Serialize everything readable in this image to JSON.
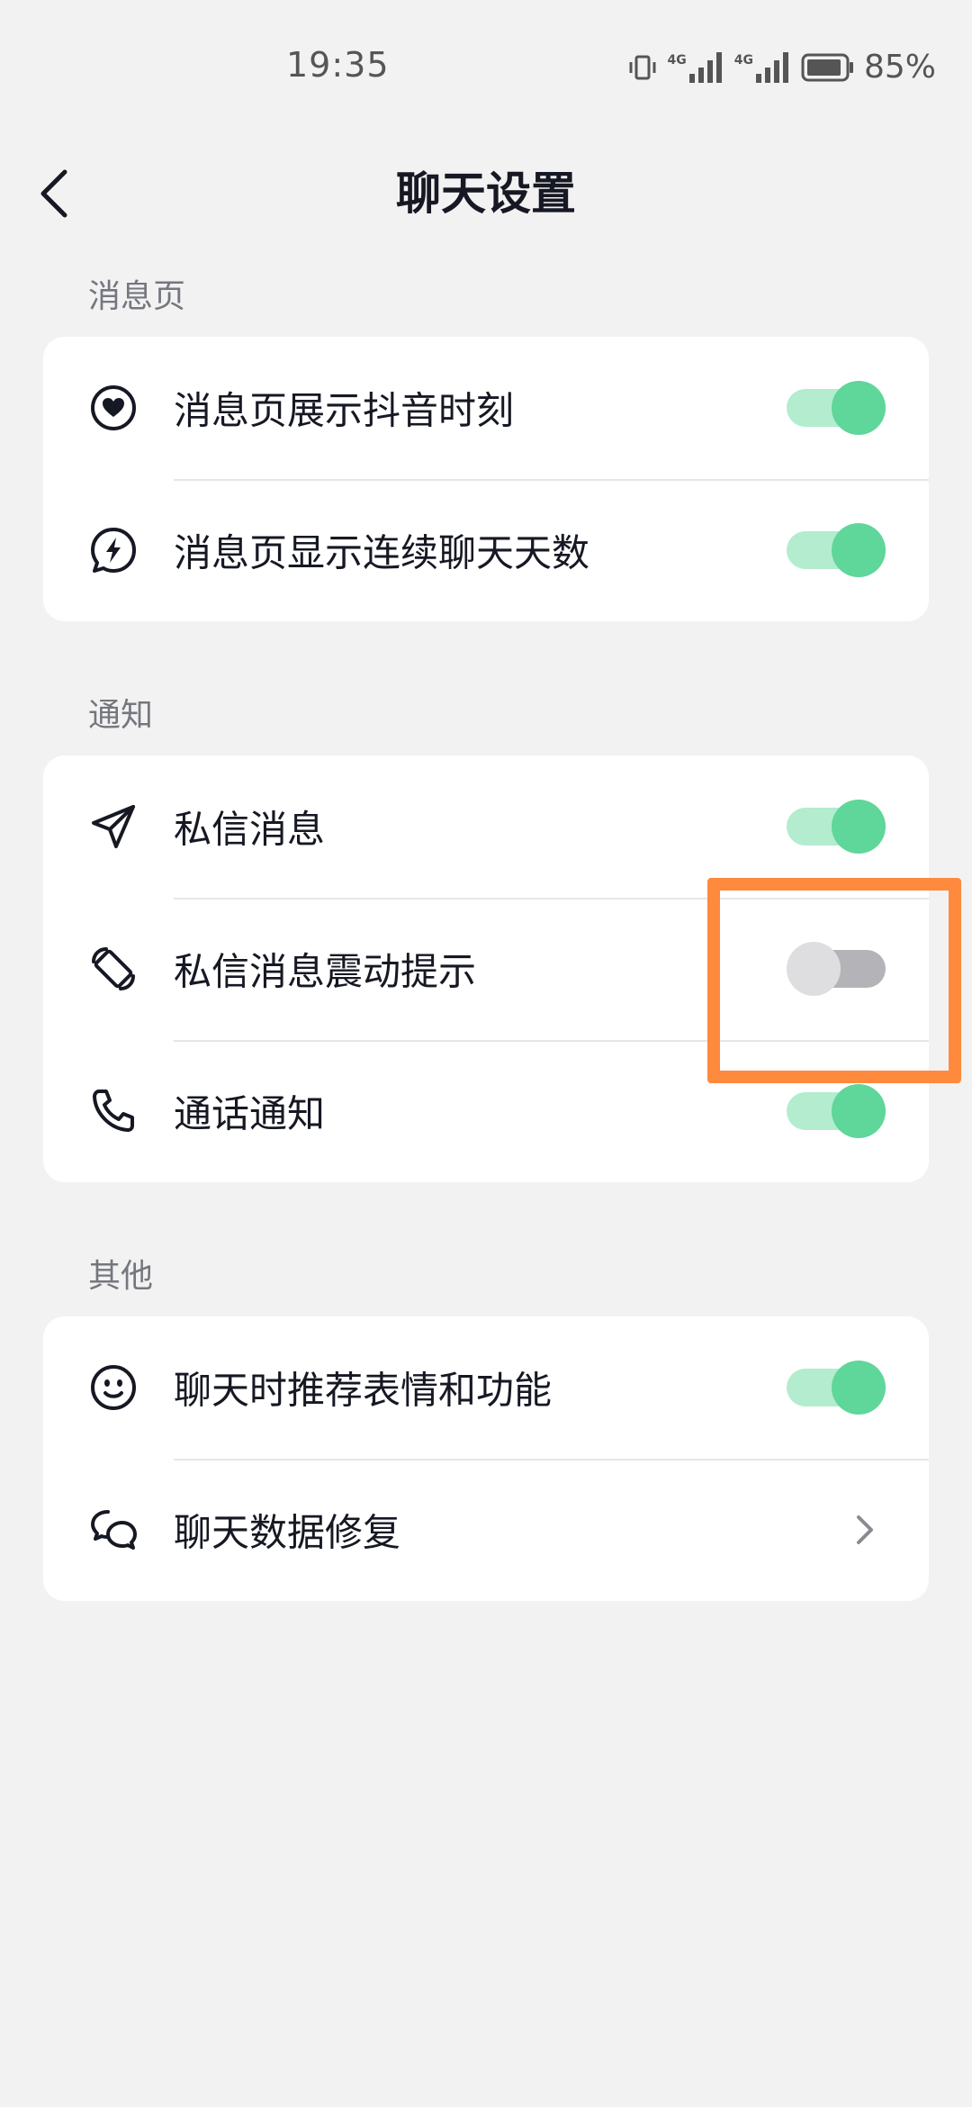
{
  "status_bar": {
    "time": "19:35",
    "network_1": "4G",
    "network_2": "4G",
    "battery": "85%"
  },
  "header": {
    "title": "聊天设置",
    "back_icon": "chevron-left-icon"
  },
  "sections": [
    {
      "label": "消息页",
      "items": [
        {
          "label": "消息页展示抖音时刻",
          "icon": "heart-circle-icon",
          "control": "toggle",
          "on": true
        },
        {
          "label": "消息页显示连续聊天天数",
          "icon": "lightning-bubble-icon",
          "control": "toggle",
          "on": true
        }
      ]
    },
    {
      "label": "通知",
      "items": [
        {
          "label": "私信消息",
          "icon": "paper-plane-icon",
          "control": "toggle",
          "on": true
        },
        {
          "label": "私信消息震动提示",
          "icon": "vibrate-phone-icon",
          "control": "toggle",
          "on": false
        },
        {
          "label": "通话通知",
          "icon": "phone-icon",
          "control": "toggle",
          "on": true
        }
      ]
    },
    {
      "label": "其他",
      "items": [
        {
          "label": "聊天时推荐表情和功能",
          "icon": "smiley-icon",
          "control": "toggle",
          "on": true
        },
        {
          "label": "聊天数据修复",
          "icon": "chat-bubbles-icon",
          "control": "chevron"
        }
      ]
    }
  ],
  "colors": {
    "toggle_on_track": "#b3ecce",
    "toggle_on_knob": "#5fd69a",
    "toggle_off_track": "#b4b4b8",
    "toggle_off_knob": "#dedee0",
    "highlight": "#ff8a3d",
    "background": "#f2f2f2"
  }
}
